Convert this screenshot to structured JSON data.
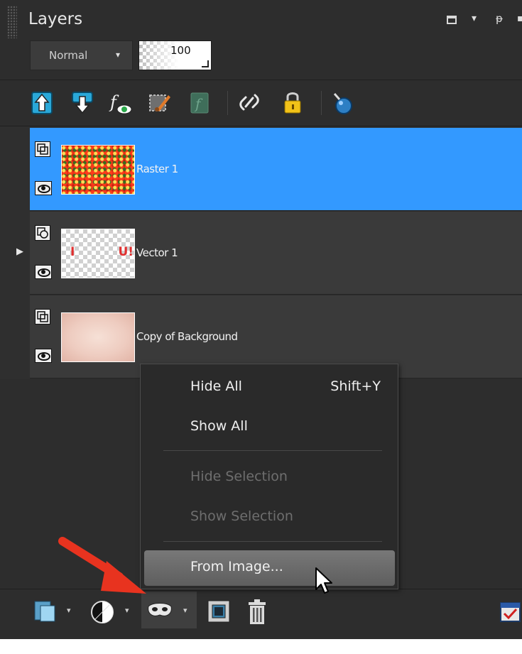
{
  "panel": {
    "title": "Layers",
    "controls": {
      "restore": "restore-icon",
      "menu": "▾",
      "pin": "ᵽ",
      "more": "▪"
    }
  },
  "blend": {
    "mode": "Normal",
    "arrow": "▾",
    "opacity": "100"
  },
  "toolbar": {
    "icons": [
      "move-up-icon",
      "move-down-icon",
      "fx-visibility-icon",
      "edit-layer-icon",
      "script-icon",
      "link-icon",
      "lock-icon",
      "drop-icon"
    ]
  },
  "layers": [
    {
      "name": "Raster 1",
      "type": "raster",
      "selected": true,
      "visible": true
    },
    {
      "name": "Vector 1",
      "type": "vector",
      "selected": false,
      "visible": true,
      "thumb_text_left": "I",
      "thumb_text_right": "U!"
    },
    {
      "name": "Copy of Background",
      "type": "raster",
      "selected": false,
      "visible": true
    }
  ],
  "context_menu": {
    "items": [
      {
        "label": "Hide All",
        "shortcut": "Shift+Y",
        "enabled": true
      },
      {
        "label": "Show All",
        "shortcut": "",
        "enabled": true
      },
      {
        "label": "Hide Selection",
        "shortcut": "",
        "enabled": false
      },
      {
        "label": "Show Selection",
        "shortcut": "",
        "enabled": false
      },
      {
        "label": "From Image...",
        "shortcut": "",
        "enabled": true,
        "highlighted": true
      }
    ]
  },
  "bottom_bar": {
    "buttons": [
      "new-layer-icon",
      "adjustment-layer-icon",
      "mask-icon",
      "group-icon",
      "delete-icon",
      "properties-icon"
    ],
    "dropdown_arrow": "▾"
  },
  "colors": {
    "selection": "#3399ff",
    "panel_bg": "#2d2d2d",
    "row_bg": "#3a3a3a",
    "annotation_arrow": "#e8331f"
  }
}
